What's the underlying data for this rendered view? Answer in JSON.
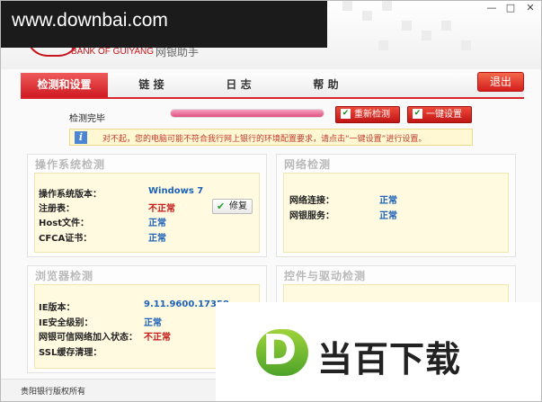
{
  "watermark": "www.downbai.com",
  "header": {
    "bank_name_en": "BANK OF GUIYANG",
    "app_name": "网银助手",
    "window_controls": {
      "minimize": "—",
      "maximize": "□",
      "close": "✕"
    }
  },
  "nav": {
    "tabs": [
      {
        "label": "检测和设置",
        "active": true
      },
      {
        "label": "链 接",
        "active": false
      },
      {
        "label": "日 志",
        "active": false
      },
      {
        "label": "帮 助",
        "active": false
      }
    ],
    "exit_label": "退出"
  },
  "status": {
    "label": "检测完毕",
    "progress": 1.0,
    "recheck_label": "重新检测",
    "oneclick_label": "一键设置",
    "info_text": "对不起，您的电脑可能不符合我行网上银行的环境配置要求，请点击“一键设置”进行设置。"
  },
  "panels": {
    "os": {
      "title": "操作系统检测",
      "rows": [
        {
          "label": "操作系统版本：",
          "value": "Windows 7",
          "status": "ok"
        },
        {
          "label": "注册表：",
          "value": "不正常",
          "status": "bad"
        },
        {
          "label": "Host文件：",
          "value": "正常",
          "status": "ok"
        },
        {
          "label": "CFCA证书：",
          "value": "正常",
          "status": "ok"
        }
      ],
      "fix_label": "修复"
    },
    "network": {
      "title": "网络检测",
      "rows": [
        {
          "label": "网络连接：",
          "value": "正常",
          "status": "ok"
        },
        {
          "label": "网银服务：",
          "value": "正常",
          "status": "ok"
        }
      ]
    },
    "browser": {
      "title": "浏览器检测",
      "rows": [
        {
          "label": "IE版本：",
          "value": "9.11.9600.17358",
          "status": "ok"
        },
        {
          "label": "IE安全级别：",
          "value": "正常",
          "status": "ok"
        },
        {
          "label": "网银可信网络加入状态：",
          "value": "不正常",
          "status": "bad"
        },
        {
          "label": "SSL缓存清理：",
          "value": "",
          "status": "ok"
        }
      ]
    },
    "driver": {
      "title": "控件与驱动检测"
    }
  },
  "footer": {
    "copyright": "贵阳银行版权所有"
  },
  "promo": {
    "brand": "当百下载",
    "logo_letter": "D"
  },
  "colors": {
    "accent_red": "#d8262c",
    "ok_blue": "#1c62b9",
    "bad_red": "#c41a1a",
    "panel_bg": "#fffae0"
  }
}
